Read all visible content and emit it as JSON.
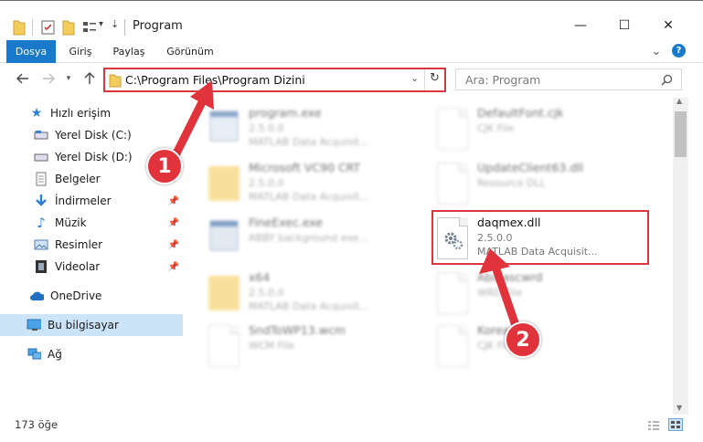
{
  "window": {
    "title": "Program",
    "minimize": "—",
    "maximize": "☐",
    "close": "✕"
  },
  "ribbon": {
    "tabs": [
      "Dosya",
      "Giriş",
      "Paylaş",
      "Görünüm"
    ],
    "expand": "⌄",
    "help": "?"
  },
  "address": {
    "path": "C:\\Program Files\\Program Dizini",
    "search_placeholder": "Ara: Program"
  },
  "sidebar": {
    "items": [
      {
        "label": "Hızlı erişim",
        "icon": "star-icon"
      },
      {
        "label": "Yerel Disk (C:)",
        "icon": "drive-icon"
      },
      {
        "label": "Yerel Disk (D:)",
        "icon": "drive-icon"
      },
      {
        "label": "Belgeler",
        "icon": "documents-icon"
      },
      {
        "label": "İndirmeler",
        "icon": "download-icon"
      },
      {
        "label": "Müzik",
        "icon": "music-icon"
      },
      {
        "label": "Resimler",
        "icon": "pictures-icon"
      },
      {
        "label": "Videolar",
        "icon": "videos-icon"
      },
      {
        "label": "OneDrive",
        "icon": "cloud-icon"
      },
      {
        "label": "Bu bilgisayar",
        "icon": "computer-icon"
      },
      {
        "label": "Ağ",
        "icon": "network-icon"
      }
    ]
  },
  "files": {
    "left": [
      {
        "name": "program.exe",
        "l2": "2.5.0.0",
        "l3": "MATLAB Data Acquisit..."
      },
      {
        "name": "Microsoft VC90 CRT",
        "l2": "2.5.0.0",
        "l3": "MATLAB Data Acquisit..."
      },
      {
        "name": "FineExec.exe",
        "l2": "ABBY background exe...",
        "l3": ""
      },
      {
        "name": "x64",
        "l2": "2.5.0.0",
        "l3": "MATLAB Data Acquisit..."
      },
      {
        "name": "SndToWP13.wcm",
        "l2": "WCM File",
        "l3": ""
      }
    ],
    "right": [
      {
        "name": "DefaultFont.cjk",
        "l2": "CJK File",
        "l3": ""
      },
      {
        "name": "UpdateClient63.dll",
        "l2": "Resource DLL",
        "l3": ""
      },
      {
        "name": "daqmex.dll",
        "l2": "2.5.0.0",
        "l3": "MATLAB Data Acquisit..."
      },
      {
        "name": "Abc.ascwrd",
        "l2": "WRD File",
        "l3": ""
      },
      {
        "name": "Korean.cjk",
        "l2": "CJK File",
        "l3": ""
      }
    ]
  },
  "status": {
    "count": "173 öğe"
  },
  "callouts": {
    "one": "1",
    "two": "2"
  },
  "colors": {
    "accent": "#1979ca",
    "callout": "#e0333b"
  }
}
